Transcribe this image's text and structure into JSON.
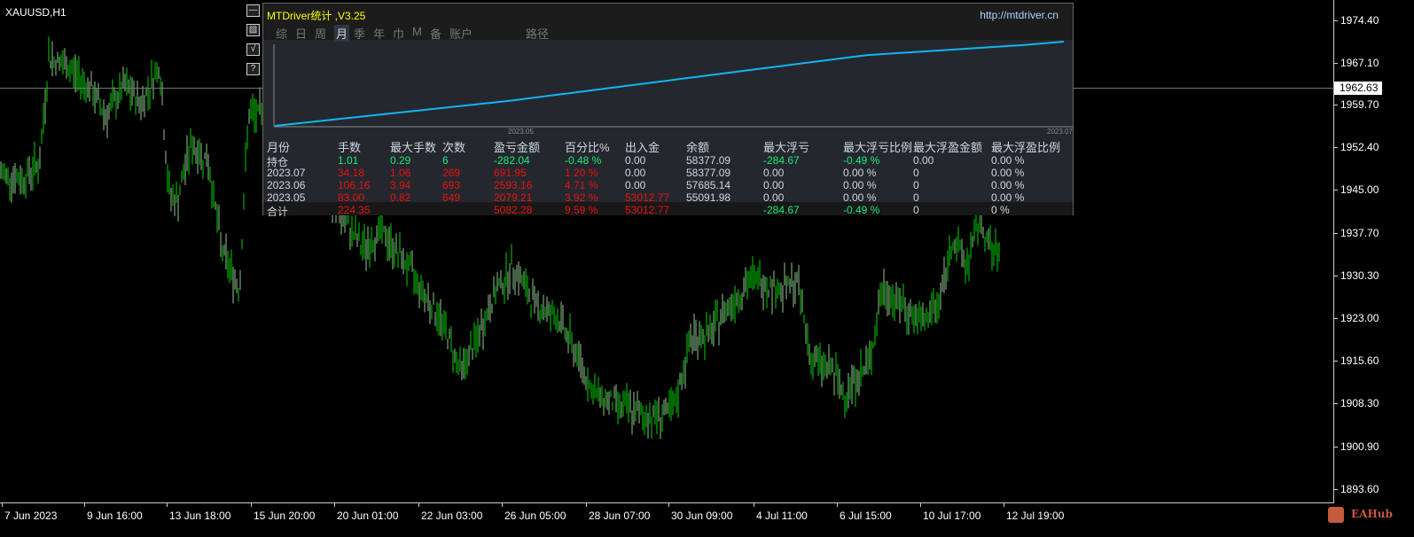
{
  "symbol": "XAUUSD,H1",
  "current_price": "1962.63",
  "price_axis": [
    "1974.40",
    "1967.10",
    "1959.70",
    "1952.40",
    "1945.00",
    "1937.70",
    "1930.30",
    "1923.00",
    "1915.60",
    "1908.30",
    "1900.90",
    "1893.60"
  ],
  "time_axis": [
    "7 Jun 2023",
    "9 Jun 16:00",
    "13 Jun 18:00",
    "15 Jun 20:00",
    "20 Jun 01:00",
    "22 Jun 03:00",
    "26 Jun 05:00",
    "28 Jun 07:00",
    "30 Jun 09:00",
    "4 Jul 11:00",
    "6 Jul 15:00",
    "10 Jul 17:00",
    "12 Jul 19:00"
  ],
  "chart_data": {
    "type": "candlestick-hl",
    "ylim": [
      1890,
      1978
    ],
    "current_price": 1962.63,
    "approx_path": [
      [
        0,
        1948
      ],
      [
        25,
        1947
      ],
      [
        45,
        1950
      ],
      [
        55,
        1968
      ],
      [
        80,
        1966
      ],
      [
        100,
        1963
      ],
      [
        120,
        1958
      ],
      [
        140,
        1963
      ],
      [
        160,
        1960
      ],
      [
        180,
        1967
      ],
      [
        190,
        1945
      ],
      [
        200,
        1943
      ],
      [
        215,
        1953
      ],
      [
        235,
        1950
      ],
      [
        250,
        1935
      ],
      [
        270,
        1928
      ],
      [
        280,
        1958
      ],
      [
        300,
        1958
      ],
      [
        330,
        1950
      ],
      [
        380,
        1942
      ],
      [
        410,
        1935
      ],
      [
        430,
        1938
      ],
      [
        460,
        1932
      ],
      [
        500,
        1922
      ],
      [
        520,
        1914
      ],
      [
        540,
        1920
      ],
      [
        560,
        1928
      ],
      [
        580,
        1932
      ],
      [
        600,
        1926
      ],
      [
        630,
        1923
      ],
      [
        650,
        1917
      ],
      [
        670,
        1910
      ],
      [
        700,
        1908
      ],
      [
        730,
        1906
      ],
      [
        760,
        1907
      ],
      [
        780,
        1920
      ],
      [
        800,
        1920
      ],
      [
        820,
        1925
      ],
      [
        850,
        1930
      ],
      [
        880,
        1928
      ],
      [
        900,
        1929
      ],
      [
        915,
        1916
      ],
      [
        940,
        1914
      ],
      [
        950,
        1910
      ],
      [
        980,
        1915
      ],
      [
        995,
        1928
      ],
      [
        1020,
        1925
      ],
      [
        1040,
        1922
      ],
      [
        1060,
        1926
      ],
      [
        1075,
        1937
      ],
      [
        1090,
        1932
      ],
      [
        1105,
        1940
      ],
      [
        1120,
        1934
      ],
      [
        1128,
        1934
      ]
    ]
  },
  "side_buttons": [
    "—",
    "▧",
    "√",
    "?"
  ],
  "panel": {
    "title": "MTDriver统计 ,V3.25",
    "url": "http://mtdriver.cn",
    "tabs": [
      "综",
      "日",
      "周",
      "月",
      "季",
      "年",
      "巾",
      "M",
      "备",
      "账户",
      "路径"
    ],
    "active_tab": "月",
    "equity": {
      "start_label": "2023.05",
      "end_label": "2023.07",
      "points": [
        0,
        0.05,
        0.1,
        0.15,
        0.2,
        0.25,
        0.3,
        0.36,
        0.42,
        0.48,
        0.54,
        0.6,
        0.66,
        0.72,
        0.78,
        0.84,
        0.87,
        0.9,
        0.93,
        0.96,
        1.0
      ]
    },
    "headers": [
      "月份",
      "手数",
      "最大手数",
      "次数",
      "盈亏金额",
      "百分比%",
      "出入金",
      "余额",
      "最大浮亏",
      "最大浮亏比例",
      "最大浮盈金额",
      "最大浮盈比例"
    ],
    "rows": [
      {
        "cells": [
          "持仓",
          "1.01",
          "0.29",
          "6",
          "-282.04",
          "-0.48 %",
          "0.00",
          "58377.09",
          "-284.67",
          "-0.49 %",
          "0.00",
          "0.00 %"
        ],
        "colors": [
          "w",
          "g",
          "g",
          "g",
          "g",
          "g",
          "w",
          "w",
          "g",
          "g",
          "w",
          "w"
        ]
      },
      {
        "cells": [
          "2023.07",
          "34.18",
          "1.06",
          "269",
          "691.95",
          "1.20 %",
          "0.00",
          "58377.09",
          "0.00",
          "0.00 %",
          "0",
          "0.00 %"
        ],
        "colors": [
          "w",
          "r",
          "r",
          "r",
          "r",
          "r",
          "w",
          "w",
          "w",
          "w",
          "w",
          "w"
        ]
      },
      {
        "cells": [
          "2023.06",
          "106.16",
          "3.94",
          "693",
          "2593.16",
          "4.71 %",
          "0.00",
          "57685.14",
          "0.00",
          "0.00 %",
          "0",
          "0.00 %"
        ],
        "colors": [
          "w",
          "r",
          "r",
          "r",
          "r",
          "r",
          "w",
          "w",
          "w",
          "w",
          "w",
          "w"
        ]
      },
      {
        "cells": [
          "2023.05",
          "83.00",
          "0.82",
          "649",
          "2079.21",
          "3.92 %",
          "53012.77",
          "55091.98",
          "0.00",
          "0.00 %",
          "0",
          "0.00 %"
        ],
        "colors": [
          "w",
          "r",
          "r",
          "r",
          "r",
          "r",
          "r",
          "w",
          "w",
          "w",
          "w",
          "w"
        ]
      },
      {
        "cells": [
          "合计",
          "224.35",
          "",
          "",
          "5082.28",
          "9.59 %",
          "53012.77",
          "",
          "-284.67",
          "-0.49 %",
          "0",
          "0 %"
        ],
        "colors": [
          "w",
          "r",
          "r",
          "r",
          "r",
          "r",
          "r",
          "w",
          "g",
          "g",
          "w",
          "w"
        ]
      }
    ]
  },
  "watermark": "EAHub"
}
